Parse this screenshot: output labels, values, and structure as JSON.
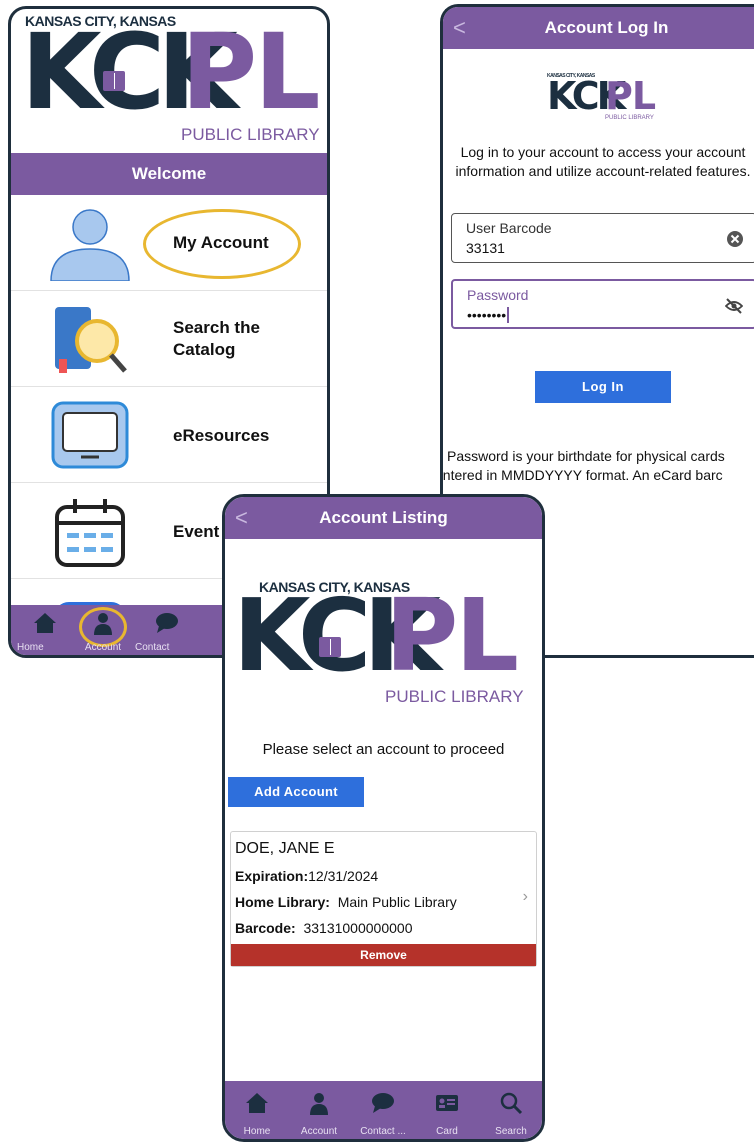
{
  "logo": {
    "top_text": "KANSAS CITY, KANSAS",
    "kc": "KCK",
    "pl": "PL",
    "sub": "PUBLIC LIBRARY"
  },
  "home": {
    "welcome": "Welcome",
    "items": [
      {
        "label": "My Account",
        "icon": "person-icon"
      },
      {
        "label": "Search the Catalog",
        "icon": "book-search-icon"
      },
      {
        "label": "eResources",
        "icon": "monitor-icon"
      },
      {
        "label": "Event",
        "icon": "calendar-icon"
      }
    ],
    "nav": [
      {
        "label": "Home",
        "icon": "home-icon"
      },
      {
        "label": "Account",
        "icon": "account-icon"
      },
      {
        "label": "Contact",
        "icon": "chat-icon"
      }
    ]
  },
  "login": {
    "title": "Account Log In",
    "intro": "Log in to your account to access your account information and utilize account-related features.",
    "barcode_label": "User Barcode",
    "barcode_value": "33131",
    "password_label": "Password",
    "password_value": "••••••••",
    "button": "Log In",
    "note_line1": "Password is your birthdate for physical cards",
    "note_line2": "entered in MMDDYYYY format.  An eCard barc"
  },
  "listing": {
    "title": "Account Listing",
    "prompt": "Please select an account to proceed",
    "add_button": "Add Account",
    "account": {
      "name": "DOE, JANE E",
      "expiration_label": "Expiration:",
      "expiration": "12/31/2024",
      "home_library_label": "Home Library:",
      "home_library": "Main Public Library",
      "barcode_label": "Barcode:",
      "barcode": "33131000000000",
      "remove": "Remove"
    },
    "nav": [
      {
        "label": "Home",
        "icon": "home-icon"
      },
      {
        "label": "Account",
        "icon": "account-icon"
      },
      {
        "label": "Contact ...",
        "icon": "chat-icon"
      },
      {
        "label": "Card",
        "icon": "card-icon"
      },
      {
        "label": "Search",
        "icon": "search-icon"
      }
    ]
  },
  "colors": {
    "purple": "#7b5aa0",
    "navy": "#1c2f40",
    "blue": "#2e6fdc",
    "red": "#b5322a",
    "gold": "#e8b730"
  }
}
